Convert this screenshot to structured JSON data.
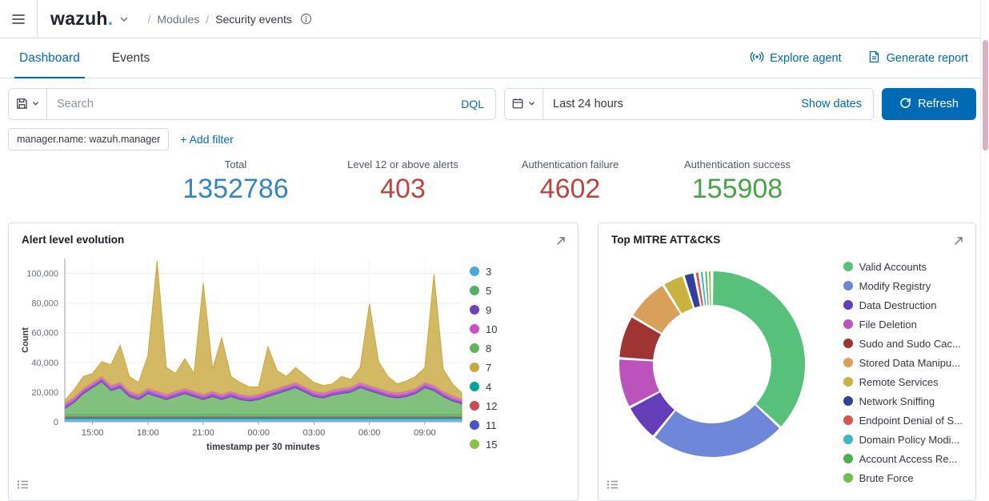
{
  "colors": {
    "primary": "#006BB4",
    "logo_dot": "#35a7e0"
  },
  "topbar": {
    "logo_text": "wazuh",
    "logo_dot": ".",
    "breadcrumb": {
      "sep1": "/",
      "modules": "Modules",
      "sep2": "/",
      "page": "Security events"
    }
  },
  "tabs": {
    "dashboard": "Dashboard",
    "events": "Events"
  },
  "actions": {
    "explore_agent": "Explore agent",
    "generate_report": "Generate report"
  },
  "querybar": {
    "search_placeholder": "Search",
    "dql_label": "DQL",
    "time_value": "Last 24 hours",
    "show_dates_label": "Show dates",
    "refresh_label": "Refresh"
  },
  "filters": {
    "pill_label": "manager.name: wazuh.manager",
    "add_filter_label": "+ Add filter"
  },
  "stats": {
    "items": [
      {
        "label": "Total",
        "value": "1352786",
        "color": "#3585c5"
      },
      {
        "label": "Level 12 or above alerts",
        "value": "403",
        "color": "#bd4540"
      },
      {
        "label": "Authentication failure",
        "value": "4602",
        "color": "#bd4540"
      },
      {
        "label": "Authentication success",
        "value": "155908",
        "color": "#47a447"
      }
    ]
  },
  "panels": {
    "alert_title": "Alert level evolution",
    "mitre_title": "Top MITRE ATT&CKS"
  },
  "icons": {
    "menu-icon": "hamburger-lines",
    "logo-chevron-down-icon": "chevron-down",
    "info-icon": "circle-i",
    "explore-agent-icon": "broadcast-antenna",
    "generate-report-icon": "document-page",
    "saved-query-icon": "floppy-disk",
    "calendar-icon": "calendar-grid",
    "refresh-icon": "circular-arrow",
    "expand-icon": "diagonal-arrow-ne",
    "panel-options-icon": "list-bullets"
  },
  "chart_data": [
    {
      "type": "area",
      "title": "Alert level evolution",
      "xlabel": "timestamp per 30 minutes",
      "ylabel": "Count",
      "ylim": [
        0,
        110000
      ],
      "yticks": [
        0,
        20000,
        40000,
        60000,
        80000,
        100000
      ],
      "grid": true,
      "legend_position": "right",
      "x_times": [
        "13:30",
        "14:00",
        "14:30",
        "15:00",
        "15:30",
        "16:00",
        "16:30",
        "17:00",
        "17:30",
        "18:00",
        "18:30",
        "19:00",
        "19:30",
        "20:00",
        "20:30",
        "21:00",
        "21:30",
        "22:00",
        "22:30",
        "23:00",
        "23:30",
        "00:00",
        "00:30",
        "01:00",
        "01:30",
        "02:00",
        "02:30",
        "03:00",
        "03:30",
        "04:00",
        "04:30",
        "05:00",
        "05:30",
        "06:00",
        "06:30",
        "07:00",
        "07:30",
        "08:00",
        "08:30",
        "09:00",
        "09:30",
        "10:00",
        "10:30",
        "11:00"
      ],
      "xtick_labels": [
        "15:00",
        "18:00",
        "21:00",
        "00:00",
        "03:00",
        "06:00",
        "09:00"
      ],
      "xtick_indices": [
        3,
        9,
        15,
        21,
        27,
        33,
        39
      ],
      "stack_order": [
        "3",
        "4",
        "11",
        "12",
        "15",
        "5",
        "8",
        "9",
        "10",
        "7"
      ],
      "series": [
        {
          "name": "3",
          "color": "#4ba6dd",
          "values": 2000
        },
        {
          "name": "5",
          "color": "#4fb265",
          "values": 1200
        },
        {
          "name": "9",
          "color": "#7040b8",
          "values": 1500
        },
        {
          "name": "10",
          "color": "#cc4ec9",
          "values": 2000
        },
        {
          "name": "8",
          "color": "#63b25c",
          "values": [
            4000,
            8000,
            14000,
            18000,
            22000,
            16000,
            18000,
            12000,
            10000,
            14000,
            12000,
            10000,
            12000,
            14000,
            12000,
            10000,
            12000,
            10000,
            12000,
            10000,
            9000,
            10000,
            12000,
            14000,
            16000,
            18000,
            15000,
            12000,
            11000,
            13000,
            14000,
            15000,
            18000,
            16000,
            14000,
            12000,
            11000,
            12000,
            14000,
            18000,
            16000,
            12000,
            9000,
            7000
          ]
        },
        {
          "name": "7",
          "color": "#c9a83d",
          "values": [
            2000,
            5000,
            8000,
            6000,
            10000,
            14000,
            25000,
            10000,
            8000,
            22000,
            88000,
            18000,
            12000,
            20000,
            12000,
            75000,
            15000,
            38000,
            10000,
            8000,
            6000,
            5000,
            30000,
            12000,
            6000,
            10000,
            8000,
            6000,
            5000,
            4000,
            8000,
            5000,
            10000,
            55000,
            18000,
            10000,
            6000,
            7000,
            8000,
            10000,
            75000,
            15000,
            8000,
            4000
          ]
        },
        {
          "name": "4",
          "color": "#00a69b",
          "values": 800
        },
        {
          "name": "12",
          "color": "#ca4b52",
          "values": 500
        },
        {
          "name": "11",
          "color": "#4356c5",
          "values": 300
        },
        {
          "name": "15",
          "color": "#8bc34a",
          "values": 200
        }
      ]
    },
    {
      "type": "pie",
      "subtype": "donut",
      "title": "Top MITRE ATT&CKS",
      "legend_position": "right",
      "slices": [
        {
          "label": "Valid Accounts",
          "value": 34,
          "color": "#57c17b"
        },
        {
          "label": "Modify Registry",
          "value": 22,
          "color": "#6f87d8"
        },
        {
          "label": "Data Destruction",
          "value": 6,
          "color": "#663db8"
        },
        {
          "label": "File Deletion",
          "value": 8,
          "color": "#bc52bc"
        },
        {
          "label": "Sudo and Sudo Cac...",
          "value": 7,
          "color": "#9e3533"
        },
        {
          "label": "Stored Data Manipu...",
          "value": 7,
          "color": "#d9a05c"
        },
        {
          "label": "Remote Services",
          "value": 3.5,
          "color": "#c9b23e"
        },
        {
          "label": "Network Sniffing",
          "value": 1.8,
          "color": "#32409b"
        },
        {
          "label": "Endpoint Denial of S...",
          "value": 0.8,
          "color": "#d4584e"
        },
        {
          "label": "Domain Policy Modi...",
          "value": 0.7,
          "color": "#3cb6c3"
        },
        {
          "label": "Account Access Re...",
          "value": 0.6,
          "color": "#4cae4c"
        },
        {
          "label": "Brute Force",
          "value": 0.6,
          "color": "#6fbf4a"
        }
      ]
    }
  ]
}
